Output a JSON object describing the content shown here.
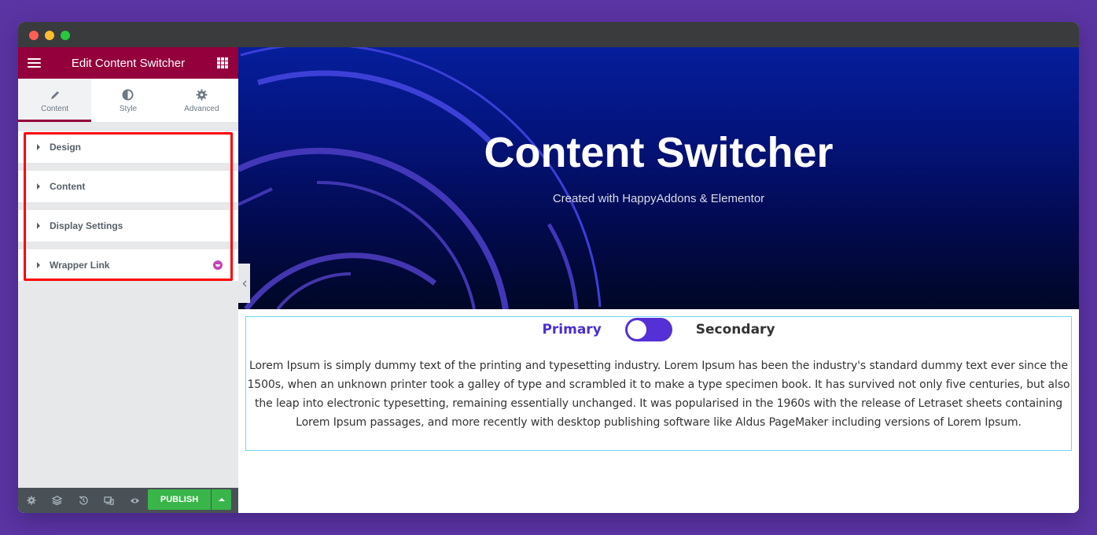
{
  "window": {
    "traffic_lights": [
      "close",
      "minimize",
      "maximize"
    ]
  },
  "sidebar": {
    "header": {
      "title": "Edit Content Switcher",
      "menu_icon": "hamburger-icon",
      "widgets_icon": "grid-icon"
    },
    "tabs": [
      {
        "label": "Content",
        "icon": "pencil-icon",
        "active": true
      },
      {
        "label": "Style",
        "icon": "half-circle-icon",
        "active": false
      },
      {
        "label": "Advanced",
        "icon": "gear-icon",
        "active": false
      }
    ],
    "sections": [
      {
        "label": "Design"
      },
      {
        "label": "Content"
      },
      {
        "label": "Display Settings"
      },
      {
        "label": "Wrapper Link",
        "badge": "happyaddons-pro-icon"
      }
    ],
    "footer": {
      "icons": [
        "settings-icon",
        "navigator-layers-icon",
        "history-icon",
        "responsive-mode-icon",
        "preview-eye-icon"
      ],
      "publish_label": "PUBLISH"
    }
  },
  "hero": {
    "title": "Content Switcher",
    "subtitle": "Created with HappyAddons & Elementor"
  },
  "switcher": {
    "primary_label": "Primary",
    "secondary_label": "Secondary",
    "active": "Primary",
    "content": "Lorem Ipsum is simply dummy text of the printing and typesetting industry. Lorem Ipsum has been the industry's standard dummy text ever since the 1500s, when an unknown printer took a galley of type and scrambled it to make a type specimen book. It has survived not only five centuries, but also the leap into electronic typesetting, remaining essentially unchanged. It was popularised in the 1960s with the release of Letraset sheets containing Lorem Ipsum passages, and more recently with desktop publishing software like Aldus PageMaker including versions of Lorem Ipsum."
  },
  "colors": {
    "brand": "#93003c",
    "publish": "#39b54a",
    "toggle": "#5530d6",
    "primary_label": "#4a2fcf",
    "highlight": "#ff0000",
    "background": "#5b35a3"
  }
}
